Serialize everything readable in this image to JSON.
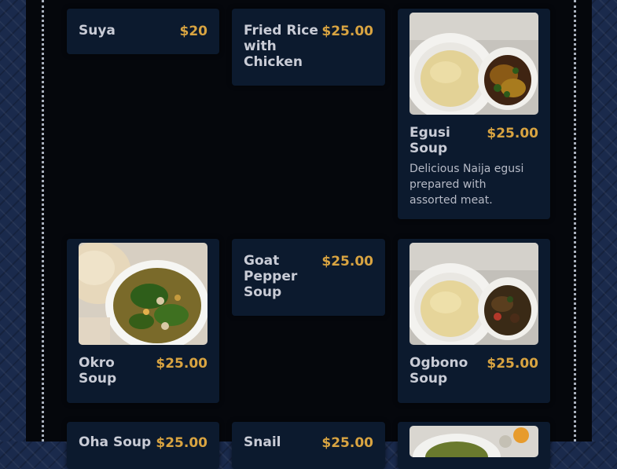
{
  "menu_items": [
    {
      "name": "Suya",
      "price": "$20"
    },
    {
      "name": "Fried Rice with Chicken",
      "price": "$25.00"
    },
    {
      "name": "Egusi Soup",
      "price": "$25.00",
      "description": "Delicious Naija egusi prepared with assorted meat."
    },
    {
      "name": "Okro Soup",
      "price": "$25.00"
    },
    {
      "name": "Goat Pepper Soup",
      "price": "$25.00"
    },
    {
      "name": "Ogbono Soup",
      "price": "$25.00"
    },
    {
      "name": "Oha Soup",
      "price": "$25.00"
    },
    {
      "name": "Snail",
      "price": "$25.00"
    }
  ],
  "colors": {
    "price": "#d9a441",
    "card": "#0c1a2e",
    "panel": "#05070c",
    "background": "#1a2a4c"
  }
}
